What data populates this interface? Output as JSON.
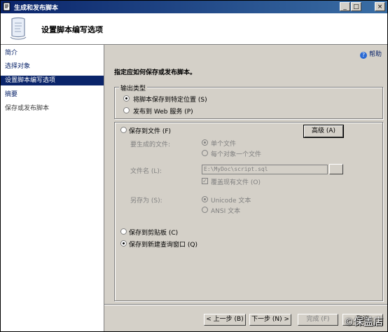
{
  "window": {
    "title": "生成和发布脚本"
  },
  "header": {
    "title": "设置脚本编写选项"
  },
  "nav": {
    "items": [
      {
        "label": "简介"
      },
      {
        "label": "选择对象"
      },
      {
        "label": "设置脚本编写选项"
      },
      {
        "label": "摘要"
      },
      {
        "label": "保存或发布脚本"
      }
    ]
  },
  "content": {
    "help_label": "帮助",
    "instruction": "指定应如何保存或发布脚本。",
    "output_type": {
      "label": "输出类型",
      "opt_save": "将脚本保存到特定位置 (S)",
      "opt_publish": "发布到 Web 服务 (P)"
    },
    "save_to_file": {
      "label": "保存到文件 (F)",
      "advanced_button": "高级 (A)",
      "files_to_generate_label": "要生成的文件:",
      "opt_single_file": "单个文件",
      "opt_one_per_object": "每个对象一个文件",
      "filename_label": "文件名 (L):",
      "filename_value": "E:\\MyDoc\\script.sql",
      "overwrite_label": "覆盖现有文件 (O)",
      "save_as_label": "另存为 (S):",
      "opt_unicode": "Unicode 文本",
      "opt_ansi": "ANSI 文本"
    },
    "save_to_clipboard": "保存到剪贴板 (C)",
    "save_to_new_query": "保存到新建查询窗口 (Q)"
  },
  "footer": {
    "back": "< 上一步 (B)",
    "next": "下一步 (N) >",
    "finish": "完成 (F)",
    "cancel": "取消"
  },
  "watermark": "©保盖店"
}
